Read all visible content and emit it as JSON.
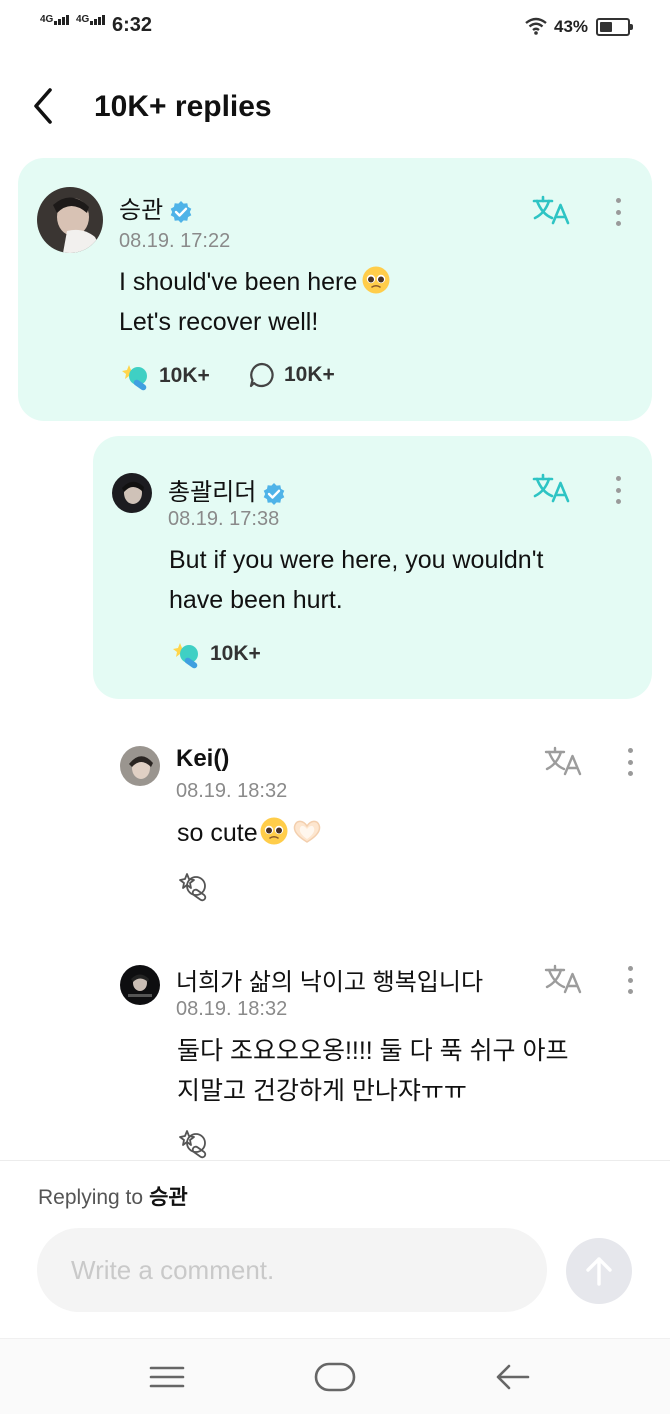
{
  "status_bar": {
    "network1": "4G",
    "network2": "4G",
    "time": "6:32",
    "battery_percent": "43%",
    "battery_level": 0.43
  },
  "header": {
    "title": "10K+ replies"
  },
  "comments": [
    {
      "name": "승관",
      "date": "08.19. 17:22",
      "lines": [
        "I should've been here",
        "Let's recover well!"
      ],
      "emoji": "pleading-face",
      "likes": "10K+",
      "replies": "10K+",
      "verified": true
    },
    {
      "name": "총괄리더",
      "date": "08.19. 17:38",
      "lines": [
        "But if you were here, you wouldn't",
        "have been hurt."
      ],
      "likes": "10K+",
      "verified": true
    },
    {
      "name": "Kei()",
      "date": "08.19. 18:32",
      "lines": [
        "so cute"
      ],
      "emoji": [
        "pleading-face",
        "heart-hands"
      ]
    },
    {
      "name": "너희가 삶의 낙이고 행복입니다",
      "date": "08.19. 18:32",
      "lines": [
        "둘다 조요오오옹!!!! 둘 다 푹 쉬구 아프",
        "지말고 건강하게 만나쟈ㅠㅠ"
      ]
    }
  ],
  "reply_bar": {
    "replying_prefix": "Replying to",
    "replying_to": "승관",
    "placeholder": "Write a comment."
  },
  "colors": {
    "accent": "#2ec4c4",
    "card_bg": "#e4fbf4",
    "verified": "#4fb3e8"
  },
  "icons": [
    "back-arrow-icon",
    "translate-icon",
    "more-icon",
    "verified-icon",
    "cheer-icon",
    "comment-icon",
    "send-arrow-icon",
    "menu-icon",
    "home-icon",
    "back-nav-icon"
  ]
}
